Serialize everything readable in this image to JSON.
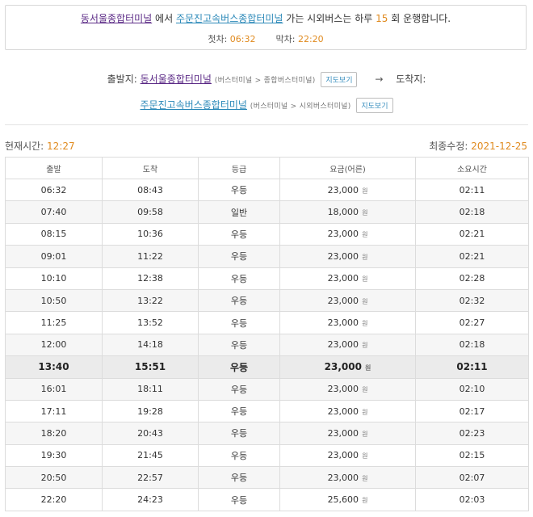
{
  "summary": {
    "origin": "동서울종합터미널",
    "from_text": "에서",
    "destination": "주문진고속버스종합터미널",
    "go_text": "가는 시외버스는 하루",
    "count": "15",
    "count_suffix": "회 운행합니다.",
    "first_label": "첫차:",
    "first_time": "06:32",
    "last_label": "막차:",
    "last_time": "22:20"
  },
  "route": {
    "departure_label": "출발지:",
    "departure_name": "동서울종합터미널",
    "departure_sub": "(버스터미널 > 종합버스터미널)",
    "departure_map": "지도보기",
    "arrow": "→",
    "arrival_label": "도착지:",
    "arrival_name": "주문진고속버스종합터미널",
    "arrival_sub": "(버스터미널 > 시외버스터미널)",
    "arrival_map": "지도보기"
  },
  "status": {
    "current_label": "현재시간:",
    "current_time": "12:27",
    "updated_label": "최종수정:",
    "updated_date": "2021-12-25"
  },
  "table": {
    "headers": [
      "출발",
      "도착",
      "등급",
      "요금(어른)",
      "소요시간"
    ],
    "currency": "원",
    "rows": [
      {
        "dep": "06:32",
        "arr": "08:43",
        "grade": "우등",
        "fare": "23,000",
        "dur": "02:11"
      },
      {
        "dep": "07:40",
        "arr": "09:58",
        "grade": "일반",
        "fare": "18,000",
        "dur": "02:18"
      },
      {
        "dep": "08:15",
        "arr": "10:36",
        "grade": "우등",
        "fare": "23,000",
        "dur": "02:21"
      },
      {
        "dep": "09:01",
        "arr": "11:22",
        "grade": "우등",
        "fare": "23,000",
        "dur": "02:21"
      },
      {
        "dep": "10:10",
        "arr": "12:38",
        "grade": "우등",
        "fare": "23,000",
        "dur": "02:28"
      },
      {
        "dep": "10:50",
        "arr": "13:22",
        "grade": "우등",
        "fare": "23,000",
        "dur": "02:32"
      },
      {
        "dep": "11:25",
        "arr": "13:52",
        "grade": "우등",
        "fare": "23,000",
        "dur": "02:27"
      },
      {
        "dep": "12:00",
        "arr": "14:18",
        "grade": "우등",
        "fare": "23,000",
        "dur": "02:18"
      },
      {
        "dep": "13:40",
        "arr": "15:51",
        "grade": "우등",
        "fare": "23,000",
        "dur": "02:11"
      },
      {
        "dep": "16:01",
        "arr": "18:11",
        "grade": "우등",
        "fare": "23,000",
        "dur": "02:10"
      },
      {
        "dep": "17:11",
        "arr": "19:28",
        "grade": "우등",
        "fare": "23,000",
        "dur": "02:17"
      },
      {
        "dep": "18:20",
        "arr": "20:43",
        "grade": "우등",
        "fare": "23,000",
        "dur": "02:23"
      },
      {
        "dep": "19:30",
        "arr": "21:45",
        "grade": "우등",
        "fare": "23,000",
        "dur": "02:15"
      },
      {
        "dep": "20:50",
        "arr": "22:57",
        "grade": "우등",
        "fare": "23,000",
        "dur": "02:07"
      },
      {
        "dep": "22:20",
        "arr": "24:23",
        "grade": "우등",
        "fare": "25,600",
        "dur": "02:03"
      }
    ]
  }
}
